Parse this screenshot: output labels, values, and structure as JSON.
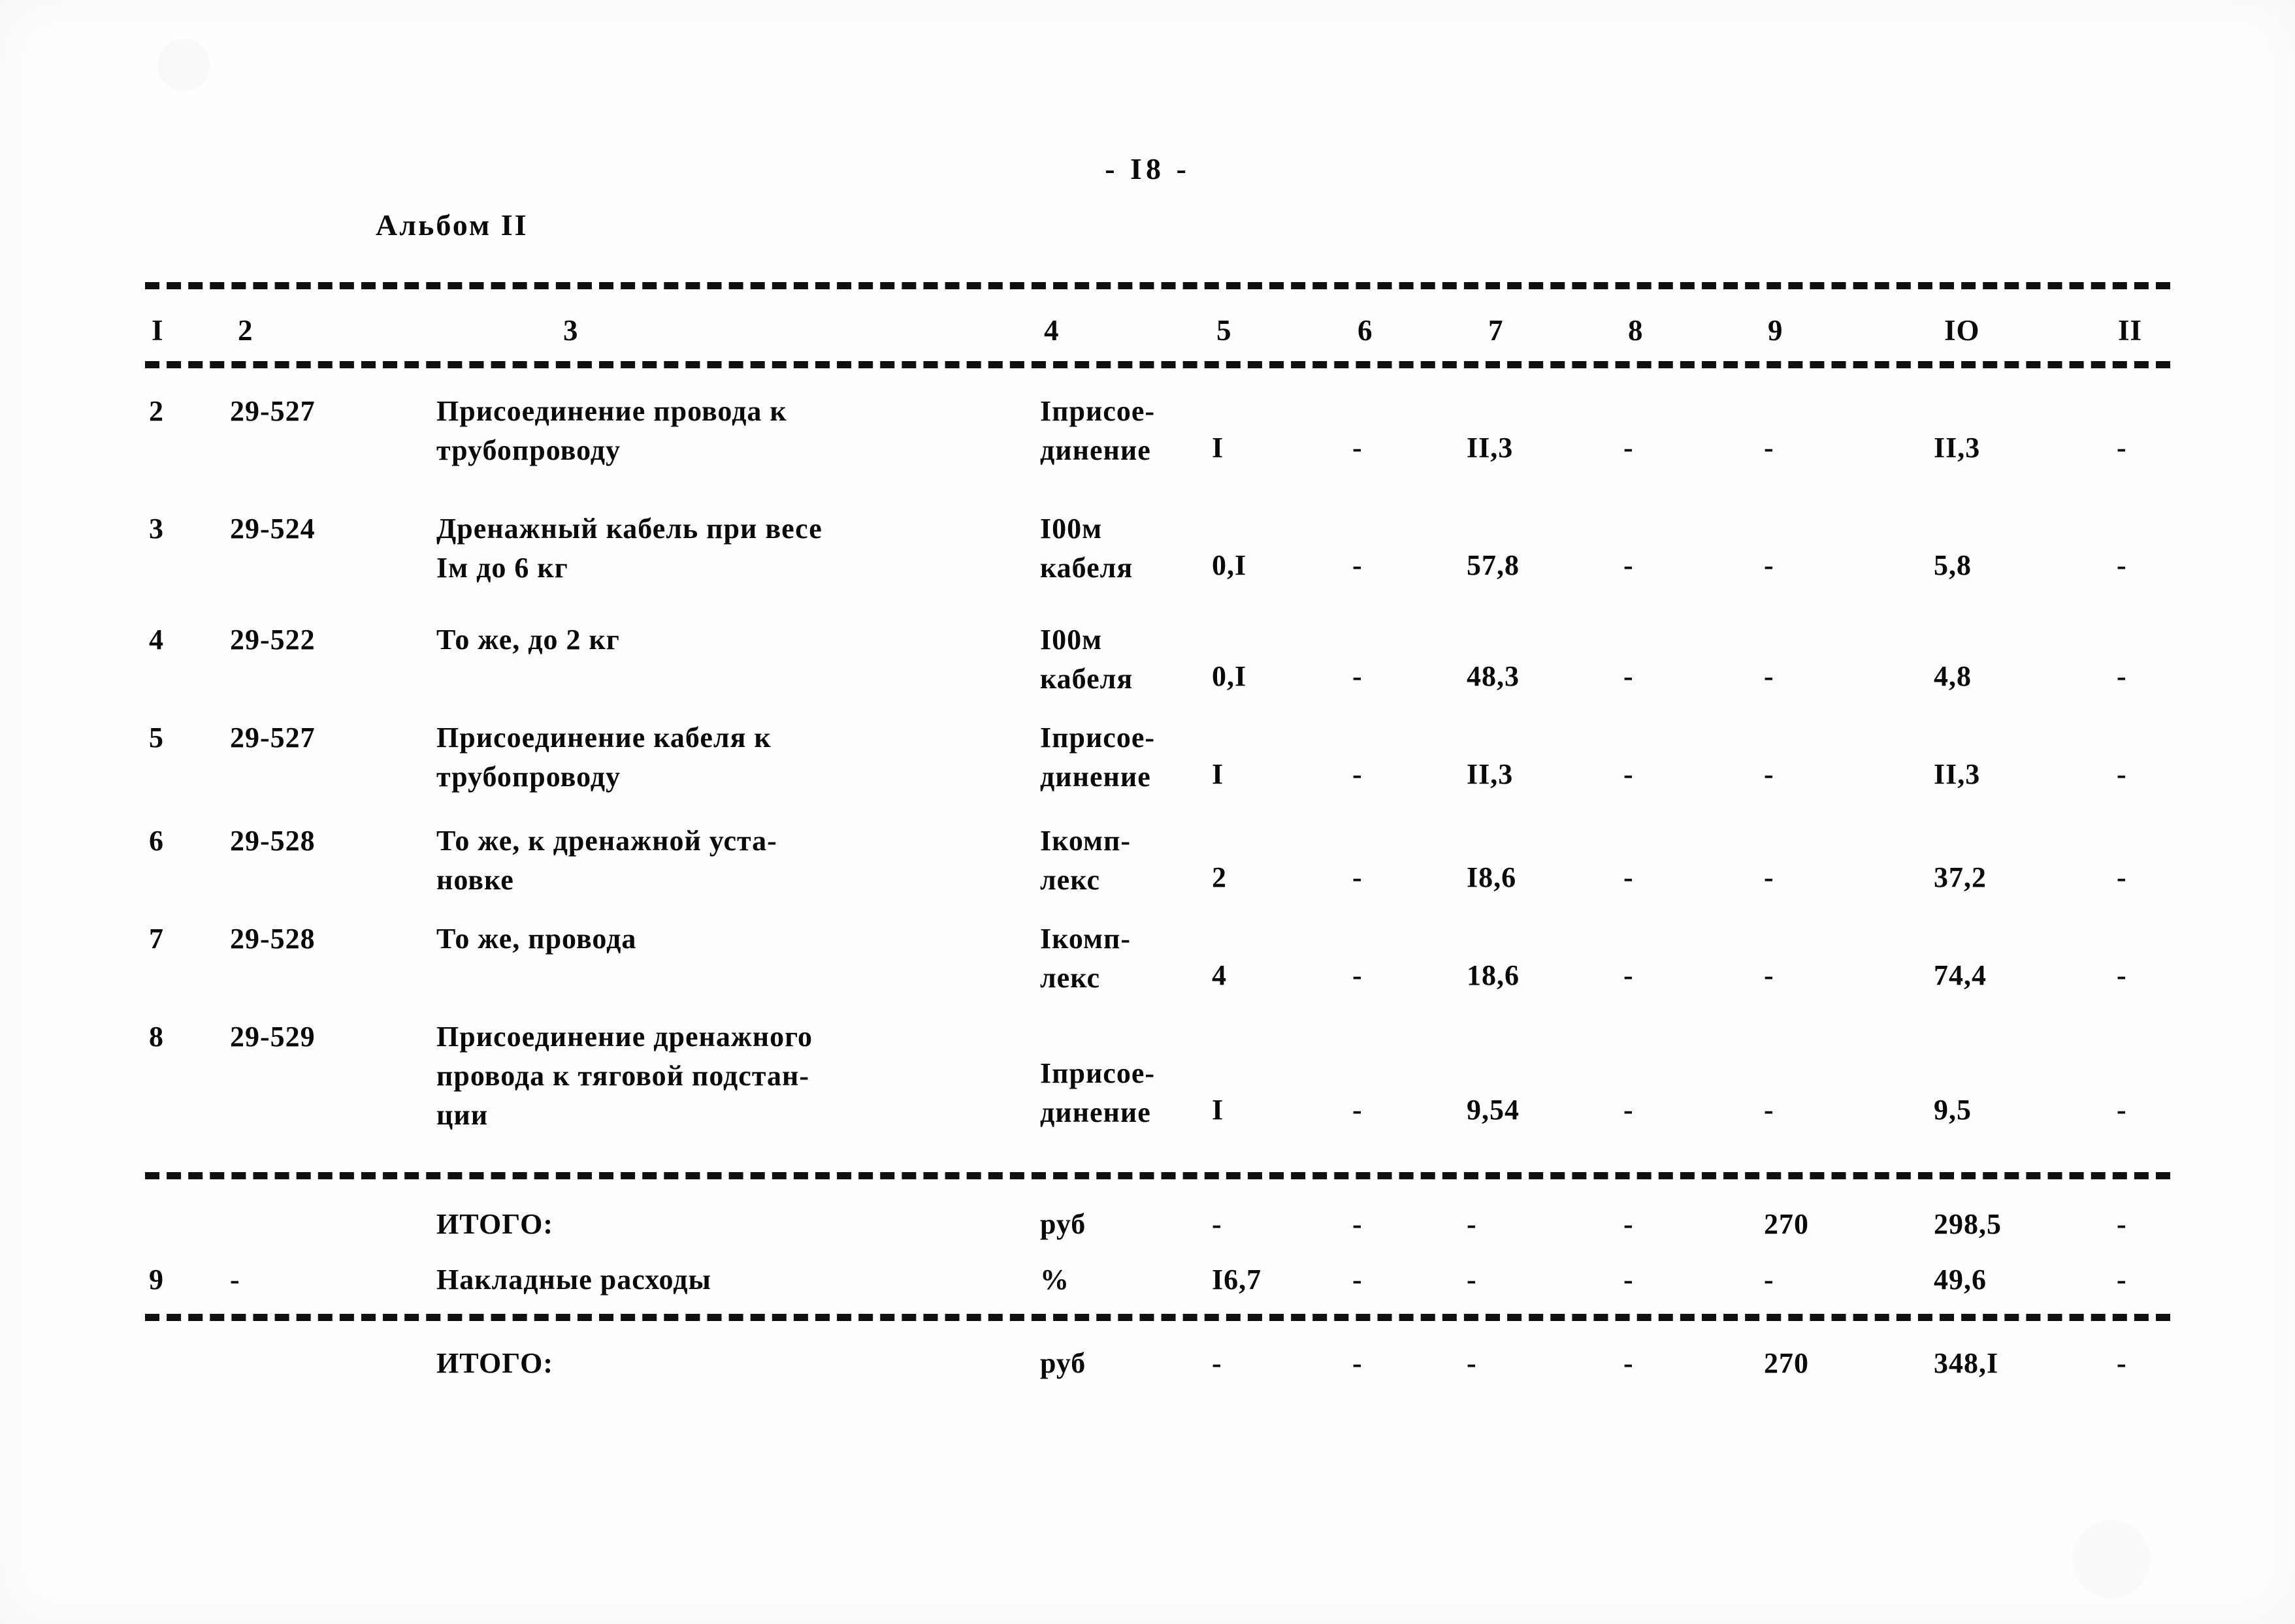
{
  "page": {
    "page_number_label": "- I8 -",
    "album_label": "Альбом II"
  },
  "table": {
    "column_headers": [
      "I",
      "2",
      "3",
      "4",
      "5",
      "6",
      "7",
      "8",
      "9",
      "IO",
      "II"
    ],
    "rows": [
      {
        "c1": "2",
        "c2": "29-527",
        "c3": "Присоединение провода к\nтрубопроводу",
        "c4": "Iприсое-\nдинение",
        "c5": "I",
        "c6": "-",
        "c7": "II,3",
        "c8": "-",
        "c9": "-",
        "c10": "II,3",
        "c11": "-"
      },
      {
        "c1": "3",
        "c2": "29-524",
        "c3": "Дренажный кабель при весе\nIм до 6 кг",
        "c4": "I00м\nкабеля",
        "c5": "0,I",
        "c6": "-",
        "c7": "57,8",
        "c8": "-",
        "c9": "-",
        "c10": "5,8",
        "c11": "-"
      },
      {
        "c1": "4",
        "c2": "29-522",
        "c3": "То же, до 2 кг",
        "c4": "I00м\nкабеля",
        "c5": "0,I",
        "c6": "-",
        "c7": "48,3",
        "c8": "-",
        "c9": "-",
        "c10": "4,8",
        "c11": "-"
      },
      {
        "c1": "5",
        "c2": "29-527",
        "c3": "Присоединение кабеля к\nтрубопроводу",
        "c4": "Iприсое-\nдинение",
        "c5": "I",
        "c6": "-",
        "c7": "II,3",
        "c8": "-",
        "c9": "-",
        "c10": "II,3",
        "c11": "-"
      },
      {
        "c1": "6",
        "c2": "29-528",
        "c3": "То же, к дренажной уста-\nновке",
        "c4": "Iкомп-\nлекс",
        "c5": "2",
        "c6": "-",
        "c7": "I8,6",
        "c8": "-",
        "c9": "-",
        "c10": "37,2",
        "c11": "-"
      },
      {
        "c1": "7",
        "c2": "29-528",
        "c3": "То же, провода",
        "c4": "Iкомп-\nлекс",
        "c5": "4",
        "c6": "-",
        "c7": "18,6",
        "c8": "-",
        "c9": "-",
        "c10": "74,4",
        "c11": "-"
      },
      {
        "c1": "8",
        "c2": "29-529",
        "c3": "Присоединение дренажного\nпровода к тяговой подстан-\nции",
        "c4": "Iприсое-\nдинение",
        "c5": "I",
        "c6": "-",
        "c7": "9,54",
        "c8": "-",
        "c9": "-",
        "c10": "9,5",
        "c11": "-"
      }
    ],
    "total_1": {
      "c1": "",
      "c2": "",
      "c3": "ИТОГО:",
      "c4": "руб",
      "c5": "-",
      "c6": "-",
      "c7": "-",
      "c8": "-",
      "c9": "270",
      "c10": "298,5",
      "c11": "-"
    },
    "overhead": {
      "c1": "9",
      "c2": "-",
      "c3": "Накладные расходы",
      "c4": "%",
      "c5": "I6,7",
      "c6": "-",
      "c7": "-",
      "c8": "-",
      "c9": "-",
      "c10": "49,6",
      "c11": "-"
    },
    "total_2": {
      "c1": "",
      "c2": "",
      "c3": "ИТОГО:",
      "c4": "руб",
      "c5": "-",
      "c6": "-",
      "c7": "-",
      "c8": "-",
      "c9": "270",
      "c10": "348,I",
      "c11": "-"
    }
  }
}
